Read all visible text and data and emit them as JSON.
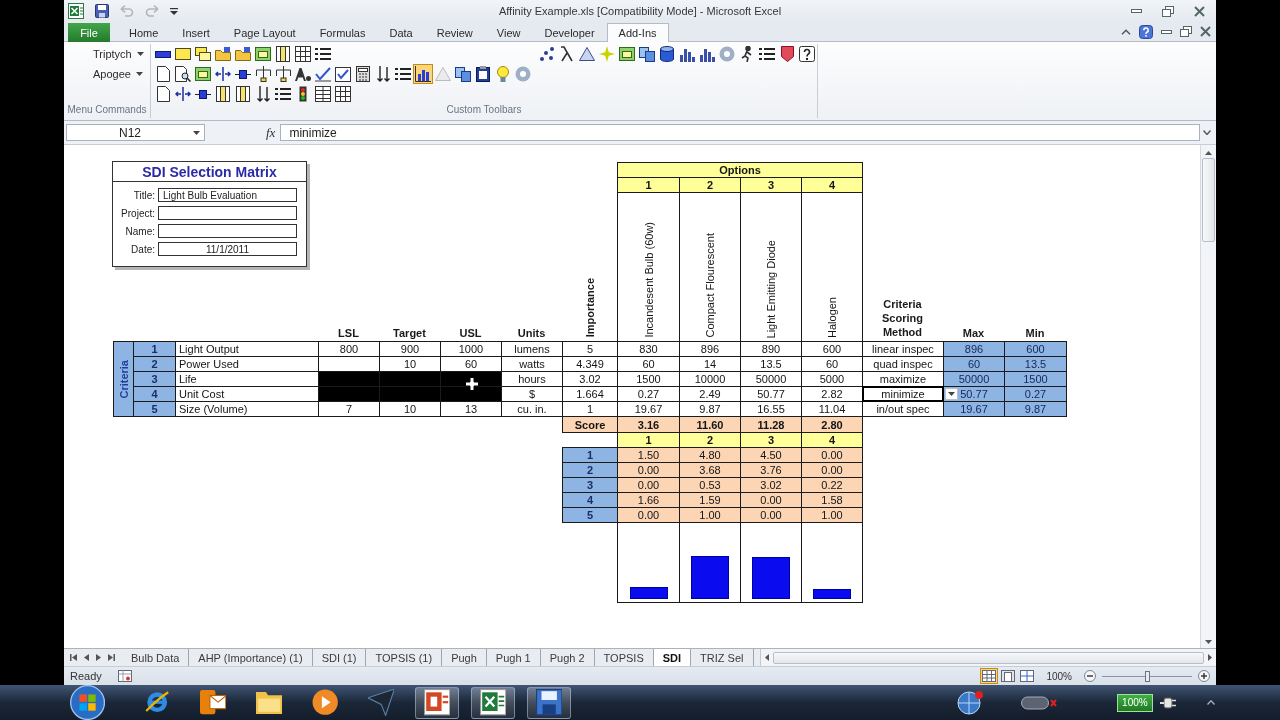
{
  "window": {
    "title": "Affinity Example.xls [Compatibility Mode] - Microsoft Excel"
  },
  "quick_access": [
    {
      "kind": "save",
      "disabled": false
    },
    {
      "kind": "undo",
      "disabled": true
    },
    {
      "kind": "redo",
      "disabled": true
    },
    {
      "kind": "customize",
      "disabled": false
    }
  ],
  "ribbon": {
    "tabs": [
      {
        "label": "File",
        "kind": "file",
        "selected": false
      },
      {
        "label": "Home",
        "kind": "tab",
        "selected": false
      },
      {
        "label": "Insert",
        "kind": "tab",
        "selected": false
      },
      {
        "label": "Page Layout",
        "kind": "tab",
        "selected": false
      },
      {
        "label": "Formulas",
        "kind": "tab",
        "selected": false
      },
      {
        "label": "Data",
        "kind": "tab",
        "selected": false
      },
      {
        "label": "Review",
        "kind": "tab",
        "selected": false
      },
      {
        "label": "View",
        "kind": "tab",
        "selected": false
      },
      {
        "label": "Developer",
        "kind": "tab",
        "selected": false
      },
      {
        "label": "Add-Ins",
        "kind": "tab",
        "selected": true
      }
    ],
    "menus": [
      "Triptych",
      "Apogee"
    ],
    "groups": [
      "Menu Commands",
      "Custom Toolbars"
    ],
    "toolbar_rows": [
      [
        {
          "kind": "bar",
          "highlighted": false,
          "disabled": false
        },
        {
          "kind": "rect",
          "highlighted": false,
          "disabled": false
        },
        {
          "kind": "stack",
          "highlighted": false,
          "disabled": false
        },
        {
          "kind": "folder",
          "highlighted": false,
          "disabled": false
        },
        {
          "kind": "folder",
          "highlighted": false,
          "disabled": false
        },
        {
          "kind": "frame",
          "highlighted": false,
          "disabled": false
        },
        {
          "kind": "columns",
          "highlighted": false,
          "disabled": false
        },
        {
          "kind": "grid",
          "highlighted": false,
          "disabled": false
        },
        {
          "kind": "list",
          "highlighted": false,
          "disabled": false
        }
      ],
      [
        {
          "kind": "page",
          "highlighted": false,
          "disabled": false
        },
        {
          "kind": "pagesearch",
          "highlighted": false,
          "disabled": false
        },
        {
          "kind": "frame",
          "highlighted": false,
          "disabled": false
        },
        {
          "kind": "split",
          "highlighted": false,
          "disabled": false
        },
        {
          "kind": "node",
          "highlighted": false,
          "disabled": false
        },
        {
          "kind": "tree",
          "highlighted": false,
          "disabled": false
        },
        {
          "kind": "tree",
          "highlighted": false,
          "disabled": false
        },
        {
          "kind": "font",
          "highlighted": false,
          "disabled": false
        },
        {
          "kind": "check",
          "highlighted": false,
          "disabled": false
        },
        {
          "kind": "form",
          "highlighted": false,
          "disabled": false
        },
        {
          "kind": "calc",
          "highlighted": false,
          "disabled": false
        },
        {
          "kind": "sort",
          "highlighted": false,
          "disabled": false
        },
        {
          "kind": "list",
          "highlighted": false,
          "disabled": false
        },
        {
          "kind": "chart",
          "highlighted": true,
          "disabled": false
        },
        {
          "kind": "triangle",
          "highlighted": false,
          "disabled": true
        },
        {
          "kind": "copy",
          "highlighted": false,
          "disabled": false
        },
        {
          "kind": "clipboard",
          "highlighted": false,
          "disabled": false
        },
        {
          "kind": "bulb",
          "highlighted": false,
          "disabled": false
        },
        {
          "kind": "gear",
          "highlighted": false,
          "disabled": false
        }
      ],
      [
        {
          "kind": "page",
          "highlighted": false,
          "disabled": false
        },
        {
          "kind": "split",
          "highlighted": false,
          "disabled": false
        },
        {
          "kind": "node",
          "highlighted": false,
          "disabled": false
        },
        {
          "kind": "columns",
          "highlighted": false,
          "disabled": false
        },
        {
          "kind": "columns",
          "highlighted": false,
          "disabled": false
        },
        {
          "kind": "sort",
          "highlighted": false,
          "disabled": false
        },
        {
          "kind": "list",
          "highlighted": false,
          "disabled": false
        },
        {
          "kind": "traffic",
          "highlighted": false,
          "disabled": false
        },
        {
          "kind": "table",
          "highlighted": false,
          "disabled": false
        },
        {
          "kind": "grid",
          "highlighted": false,
          "disabled": false
        }
      ]
    ],
    "toolbar_right": [
      {
        "kind": "scatter",
        "highlighted": false,
        "disabled": false
      },
      {
        "kind": "lambda",
        "highlighted": false,
        "disabled": false
      },
      {
        "kind": "triangle",
        "highlighted": false,
        "disabled": false
      },
      {
        "kind": "sparkle",
        "highlighted": false,
        "disabled": false
      },
      {
        "kind": "frame",
        "highlighted": false,
        "disabled": false
      },
      {
        "kind": "copy",
        "highlighted": false,
        "disabled": false
      },
      {
        "kind": "database",
        "highlighted": false,
        "disabled": false
      },
      {
        "kind": "histogram",
        "highlighted": false,
        "disabled": false
      },
      {
        "kind": "histogram",
        "highlighted": false,
        "disabled": false
      },
      {
        "kind": "gear",
        "highlighted": false,
        "disabled": false
      },
      {
        "kind": "figure",
        "highlighted": false,
        "disabled": false
      },
      {
        "kind": "list",
        "highlighted": false,
        "disabled": false
      },
      {
        "kind": "tag",
        "highlighted": false,
        "disabled": false
      },
      {
        "kind": "help",
        "highlighted": false,
        "disabled": false
      }
    ]
  },
  "formula_bar": {
    "name_box": "N12",
    "function_label": "fx",
    "value": "minimize"
  },
  "info_box": {
    "title": "SDI Selection Matrix",
    "fields": [
      {
        "label": "Title:",
        "kind": "text",
        "value": "Light Bulb Evaluation"
      },
      {
        "label": "Project:",
        "kind": "text"
      },
      {
        "label": "Name:",
        "kind": "text"
      },
      {
        "label": "Date:",
        "kind": "date",
        "value": "11/1/2011"
      }
    ]
  },
  "matrix": {
    "options_label": "Options",
    "options": [
      {
        "number": "1",
        "name": "Incandesent Bulb (60w)"
      },
      {
        "number": "2",
        "name": "Compact Flourescent"
      },
      {
        "number": "3",
        "name": "Light Emitting Diode"
      },
      {
        "number": "4",
        "name": "Halogen"
      }
    ],
    "side_label": "Criteria",
    "headers": {
      "lsl": "LSL",
      "target": "Target",
      "usl": "USL",
      "units": "Units",
      "importance": "Importance",
      "method": "Criteria Scoring Method",
      "max": "Max",
      "min": "Min"
    },
    "criteria": [
      {
        "number": "1",
        "name": "Light Output",
        "lsl": "800",
        "target": "900",
        "usl": "1000",
        "blacked_out": false,
        "units": "lumens",
        "importance": "5",
        "values": [
          "830",
          "896",
          "890",
          "600"
        ],
        "method": "linear inspec",
        "method_selected": false,
        "max": "896",
        "min": "600"
      },
      {
        "number": "2",
        "name": "Power Used",
        "target": "10",
        "usl": "60",
        "blacked_out": false,
        "units": "watts",
        "importance": "4.349",
        "values": [
          "60",
          "14",
          "13.5",
          "60"
        ],
        "method": "quad inspec",
        "method_selected": false,
        "max": "60",
        "min": "13.5"
      },
      {
        "number": "3",
        "name": "Life",
        "blacked_out": true,
        "units": "hours",
        "importance": "3.02",
        "values": [
          "1500",
          "10000",
          "50000",
          "5000"
        ],
        "method": "maximize",
        "method_selected": false,
        "max": "50000",
        "min": "1500"
      },
      {
        "number": "4",
        "name": "Unit Cost",
        "blacked_out": true,
        "units": "$",
        "importance": "1.664",
        "values": [
          "0.27",
          "2.49",
          "50.77",
          "2.82"
        ],
        "method": "minimize",
        "method_selected": true,
        "max": "50.77",
        "min": "0.27"
      },
      {
        "number": "5",
        "name": "Size (Volume)",
        "lsl": "7",
        "target": "10",
        "usl": "13",
        "blacked_out": false,
        "units": "cu. in.",
        "importance": "1",
        "values": [
          "19.67",
          "9.87",
          "16.55",
          "11.04"
        ],
        "method": "in/out spec",
        "method_selected": false,
        "max": "19.67",
        "min": "9.87"
      }
    ],
    "score_label": "Score",
    "scores": [
      "3.16",
      "11.60",
      "11.28",
      "2.80"
    ],
    "breakdown": {
      "option_numbers": [
        "1",
        "2",
        "3",
        "4"
      ],
      "rows": [
        {
          "number": "1",
          "values": [
            "1.50",
            "4.80",
            "4.50",
            "0.00"
          ]
        },
        {
          "number": "2",
          "values": [
            "0.00",
            "3.68",
            "3.76",
            "0.00"
          ]
        },
        {
          "number": "3",
          "values": [
            "0.00",
            "0.53",
            "3.02",
            "0.22"
          ]
        },
        {
          "number": "4",
          "values": [
            "1.66",
            "1.59",
            "0.00",
            "1.58"
          ]
        },
        {
          "number": "5",
          "values": [
            "0.00",
            "1.00",
            "0.00",
            "1.00"
          ]
        }
      ]
    }
  },
  "pointer": {
    "kind": "cross"
  },
  "sheet_tabs": [
    {
      "label": "Bulb Data",
      "selected": false
    },
    {
      "label": "AHP (Importance) (1)",
      "selected": false
    },
    {
      "label": "SDI (1)",
      "selected": false
    },
    {
      "label": "TOPSIS (1)",
      "selected": false
    },
    {
      "label": "Pugh",
      "selected": false
    },
    {
      "label": "Pugh 1",
      "selected": false
    },
    {
      "label": "Pugh 2",
      "selected": false
    },
    {
      "label": "TOPSIS",
      "selected": false
    },
    {
      "label": "SDI",
      "selected": true
    },
    {
      "label": "TRIZ Sel",
      "selected": false
    }
  ],
  "status_bar": {
    "text": "Ready",
    "views": [
      {
        "kind": "normal",
        "selected": true
      },
      {
        "kind": "layout",
        "selected": false
      },
      {
        "kind": "pbreak",
        "selected": false
      }
    ],
    "zoom": "100%",
    "zoom_slider": {
      "level": 0.5
    }
  },
  "taskbar": {
    "items": [
      {
        "kind": "browser",
        "running": false
      },
      {
        "kind": "mail",
        "running": false
      },
      {
        "kind": "files",
        "running": false
      },
      {
        "kind": "media",
        "running": false
      },
      {
        "kind": "arrowhead",
        "running": false
      },
      {
        "kind": "slides",
        "running": true
      },
      {
        "kind": "spreadsheet",
        "running": true
      },
      {
        "kind": "disk",
        "running": true
      }
    ],
    "battery": "100%"
  }
}
